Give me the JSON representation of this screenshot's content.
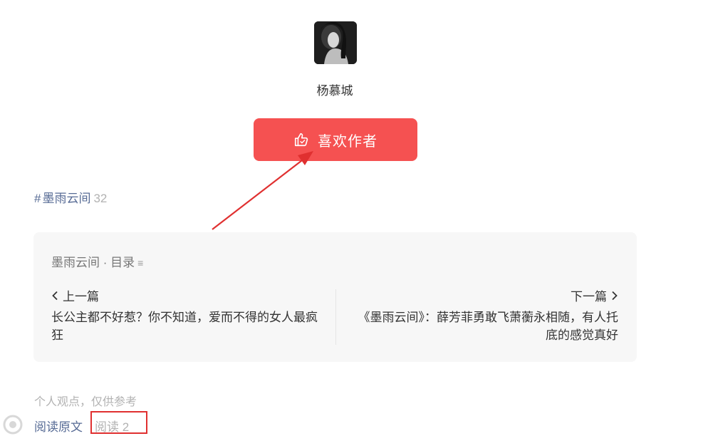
{
  "author": {
    "name": "杨慕城",
    "like_button_label": "喜欢作者"
  },
  "hashtag": {
    "symbol": "#",
    "name": "墨雨云间",
    "count": "32"
  },
  "series_card": {
    "header": "墨雨云间 · 目录",
    "menu_glyph": "≡",
    "prev": {
      "label": "上一篇",
      "title": "长公主都不好惹？你不知道，爱而不得的女人最疯狂"
    },
    "next": {
      "label": "下一篇",
      "title": "《墨雨云间》：薛芳菲勇敢飞萧蘅永相随，有人托底的感觉真好"
    }
  },
  "footer": {
    "note": "个人观点，仅供参考",
    "read_original": "阅读原文",
    "read_count": "阅读 2"
  },
  "colors": {
    "like_button": "#f55151",
    "link": "#576b95",
    "annotation_red": "#e03030"
  }
}
